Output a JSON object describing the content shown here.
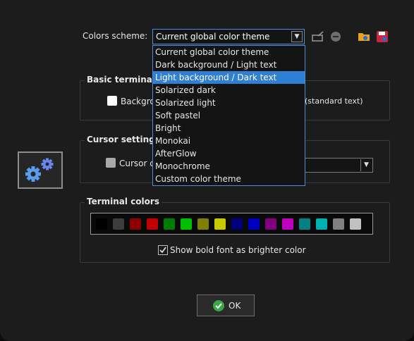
{
  "scheme": {
    "label": "Colors scheme:",
    "value": "Current global color theme",
    "options": [
      "Current global color theme",
      "Dark background / Light text",
      "Light background / Dark text",
      "Solarized dark",
      "Solarized light",
      "Soft pastel",
      "Bright",
      "Monokai",
      "AfterGlow",
      "Monochrome",
      "Custom color theme"
    ],
    "highlighted": "Light background / Dark text"
  },
  "icons": {
    "rename": "rename-icon",
    "delete": "remove-icon",
    "open": "open-folder-icon",
    "save": "save-icon",
    "app": "settings-gears-icon",
    "ok": "check-icon"
  },
  "basic": {
    "title": "Basic terminal c",
    "background_label": "Backgro",
    "text_label": "(standard text)"
  },
  "cursor": {
    "title": "Cursor settings",
    "label": "Cursor c"
  },
  "terminal": {
    "title": "Terminal colors",
    "colors": [
      "#000000",
      "#3d3d3d",
      "#8b0000",
      "#c00000",
      "#007a00",
      "#00c000",
      "#808000",
      "#c8c800",
      "#00007a",
      "#0000c0",
      "#800080",
      "#c000c0",
      "#008080",
      "#00b0b0",
      "#808080",
      "#c0c0c0"
    ],
    "bold_label": "Show bold font as brighter color",
    "bold_checked": true
  },
  "ok_label": "OK",
  "theme": {
    "accent": "#2f7fd4",
    "border": "#4d8fd6"
  }
}
